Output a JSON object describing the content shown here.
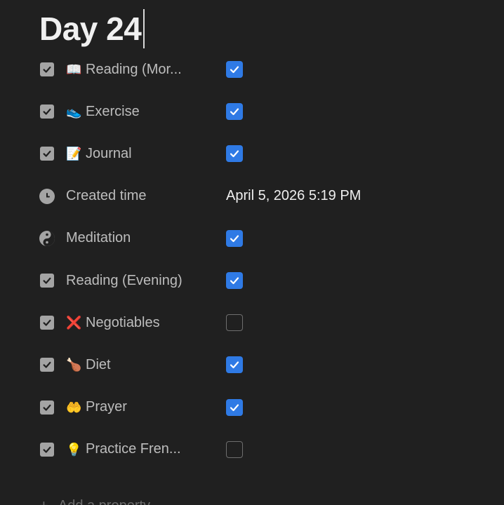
{
  "page": {
    "title": "Day 24"
  },
  "properties": [
    {
      "emoji": "📖",
      "label": "Reading (Mor...",
      "type": "checkbox",
      "checked": true
    },
    {
      "emoji": "👟",
      "label": "Exercise",
      "type": "checkbox",
      "checked": true
    },
    {
      "emoji": "📝",
      "label": "Journal",
      "type": "checkbox",
      "checked": true
    },
    {
      "emoji": "",
      "label": "Created time",
      "type": "created_time",
      "value": "April 5, 2026 5:19 PM",
      "icon": "clock-icon"
    },
    {
      "emoji": "",
      "label": "Meditation",
      "type": "checkbox",
      "checked": true,
      "icon": "yin-yang-icon"
    },
    {
      "emoji": "",
      "label": "Reading (Evening)",
      "type": "checkbox",
      "checked": true
    },
    {
      "emoji": "❌",
      "label": "Negotiables",
      "type": "checkbox",
      "checked": false
    },
    {
      "emoji": "🍗",
      "label": "Diet",
      "type": "checkbox",
      "checked": true
    },
    {
      "emoji": "🤲",
      "label": "Prayer",
      "type": "checkbox",
      "checked": true
    },
    {
      "emoji": "💡",
      "label": "Practice Fren...",
      "type": "checkbox",
      "checked": false
    }
  ],
  "add_property": {
    "label": "Add a property"
  },
  "colors": {
    "background": "#202020",
    "checkbox_on": "#2f7ae5",
    "type_icon": "#a4a4a4"
  }
}
